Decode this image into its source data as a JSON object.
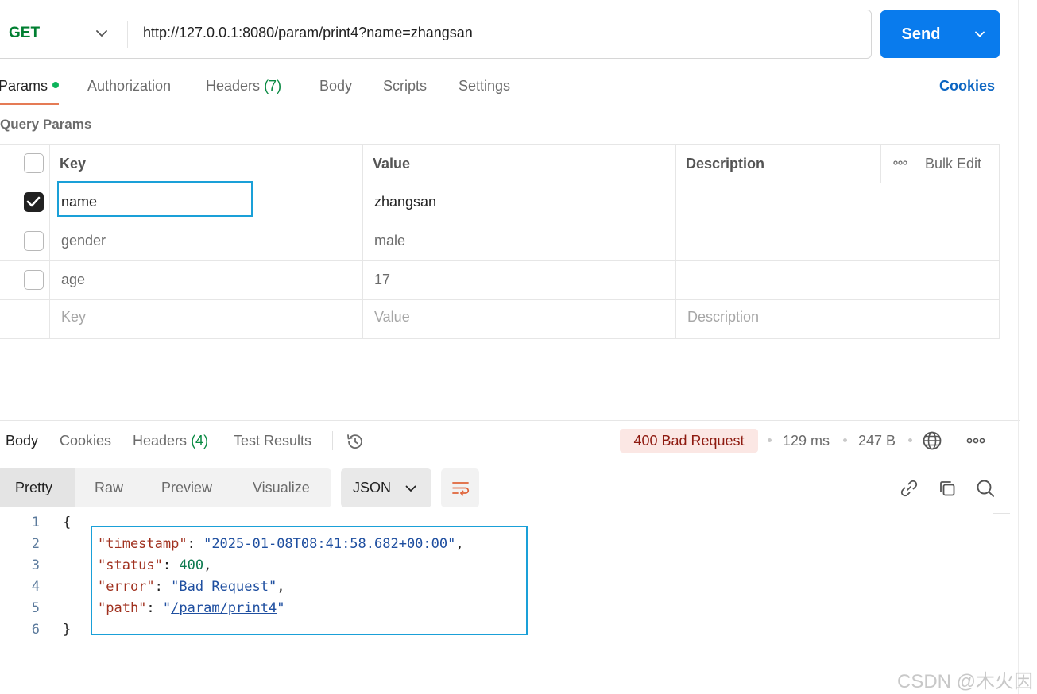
{
  "request": {
    "method": "GET",
    "url": "http://127.0.0.1:8080/param/print4?name=zhangsan",
    "send_label": "Send"
  },
  "request_tabs": {
    "params": "Params",
    "authorization": "Authorization",
    "headers": "Headers",
    "headers_count": "(7)",
    "body": "Body",
    "scripts": "Scripts",
    "settings": "Settings",
    "cookies": "Cookies"
  },
  "query_params": {
    "title": "Query Params",
    "columns": {
      "key": "Key",
      "value": "Value",
      "description": "Description",
      "bulk_edit": "Bulk Edit"
    },
    "rows": [
      {
        "checked": true,
        "key": "name",
        "value": "zhangsan",
        "description": ""
      },
      {
        "checked": false,
        "key": "gender",
        "value": "male",
        "description": ""
      },
      {
        "checked": false,
        "key": "age",
        "value": "17",
        "description": ""
      }
    ],
    "placeholder": {
      "key": "Key",
      "value": "Value",
      "description": "Description"
    }
  },
  "response_tabs": {
    "body": "Body",
    "cookies": "Cookies",
    "headers": "Headers",
    "headers_count": "(4)",
    "test_results": "Test Results"
  },
  "response_meta": {
    "status": "400 Bad Request",
    "time": "129 ms",
    "size": "247 B"
  },
  "view": {
    "pretty": "Pretty",
    "raw": "Raw",
    "preview": "Preview",
    "visualize": "Visualize",
    "format": "JSON"
  },
  "response_body": {
    "line_numbers": [
      "1",
      "2",
      "3",
      "4",
      "5",
      "6"
    ],
    "open_brace": "{",
    "close_brace": "}",
    "fields": {
      "timestamp_key": "\"timestamp\"",
      "timestamp_value": "\"2025-01-08T08:41:58.682+00:00\"",
      "status_key": "\"status\"",
      "status_value": "400",
      "error_key": "\"error\"",
      "error_value": "\"Bad Request\"",
      "path_key": "\"path\"",
      "path_value": "/param/print4"
    }
  },
  "watermark": "CSDN @木火因",
  "colors": {
    "send": "#097bed",
    "method": "#007f31",
    "accent_tab": "#e57b55",
    "status_bg": "#fbe7e4",
    "status_text": "#8e1a10",
    "focus": "#1aa0d8"
  },
  "icons": [
    "chevron-down-icon",
    "history-icon",
    "globe-icon",
    "more-icon",
    "wrap-icon",
    "link-icon",
    "copy-icon",
    "search-icon",
    "check-icon"
  ]
}
